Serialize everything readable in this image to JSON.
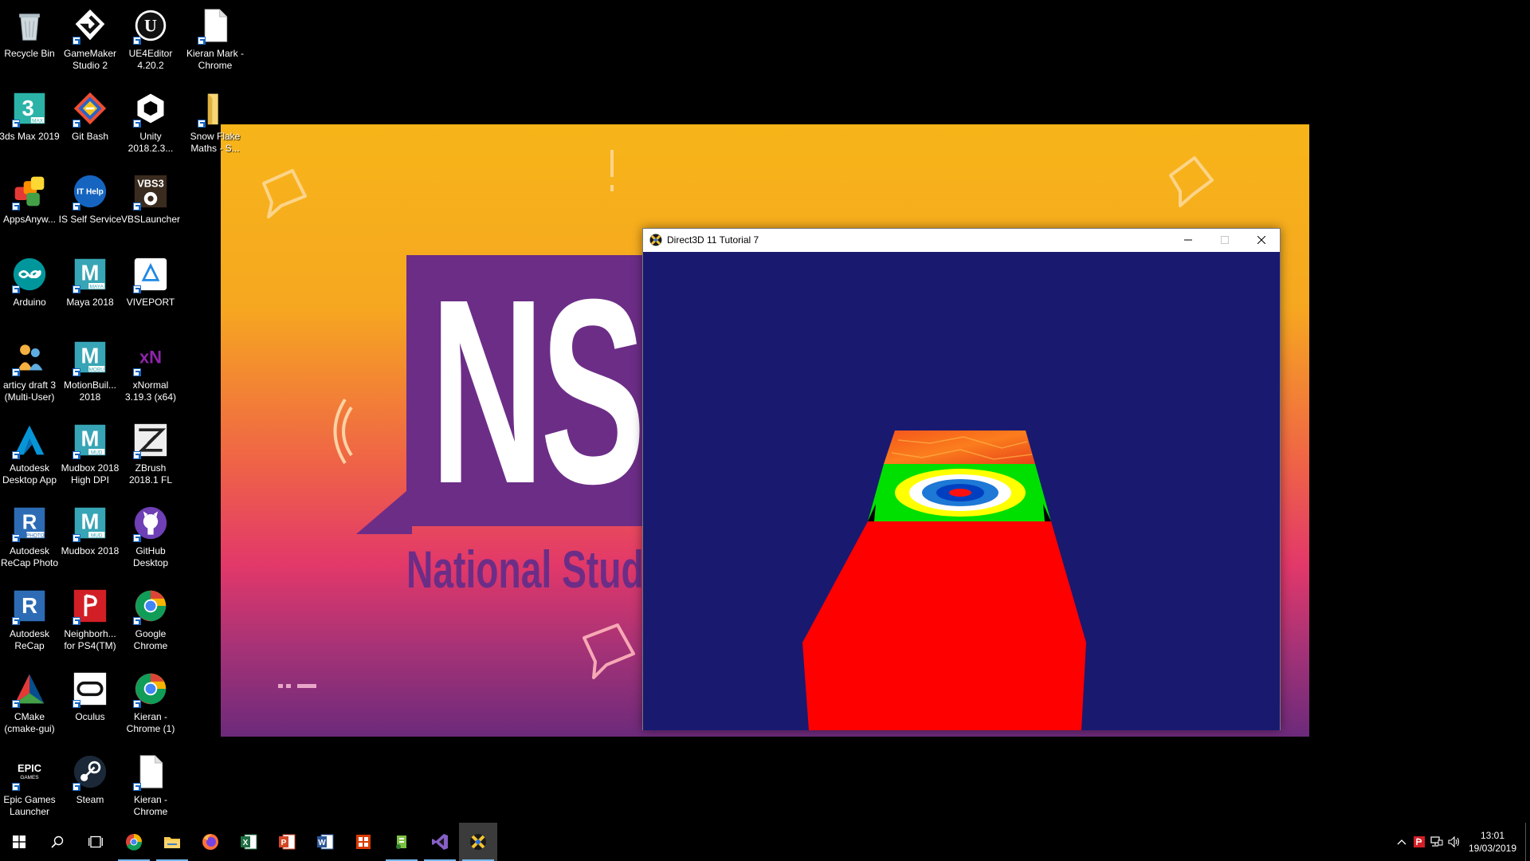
{
  "desktop_icons": [
    {
      "label": "Recycle Bin",
      "icon": "recycle-bin-icon"
    },
    {
      "label": "GameMaker\nStudio 2",
      "icon": "gamemaker-icon"
    },
    {
      "label": "UE4Editor\n4.20.2",
      "icon": "unreal-icon"
    },
    {
      "label": "Kieran Mark -\nChrome",
      "icon": "document-icon"
    },
    {
      "label": "3ds Max 2019",
      "icon": "3dsmax-icon"
    },
    {
      "label": "Git Bash",
      "icon": "git-bash-icon"
    },
    {
      "label": "Unity\n2018.2.3...",
      "icon": "unity-icon"
    },
    {
      "label": "Snow Flake\nMaths - S...",
      "icon": "folder-icon"
    },
    {
      "label": "AppsAnyw...",
      "icon": "appsanywhere-icon"
    },
    {
      "label": "IS Self Service",
      "icon": "it-help-icon"
    },
    {
      "label": "VBSLauncher",
      "icon": "vbs3-icon"
    },
    {
      "label": "Arduino",
      "icon": "arduino-icon"
    },
    {
      "label": "Maya 2018",
      "icon": "maya-icon"
    },
    {
      "label": "VIVEPORT",
      "icon": "viveport-icon"
    },
    {
      "label": "articy draft 3\n(Multi-User)",
      "icon": "articy-icon"
    },
    {
      "label": "MotionBuil...\n2018",
      "icon": "motionbuilder-icon"
    },
    {
      "label": "xNormal\n3.19.3 (x64)",
      "icon": "xnormal-icon"
    },
    {
      "label": "Autodesk\nDesktop App",
      "icon": "autodesk-icon"
    },
    {
      "label": "Mudbox 2018\nHigh DPI",
      "icon": "mudbox-icon"
    },
    {
      "label": "ZBrush\n2018.1 FL",
      "icon": "zbrush-icon"
    },
    {
      "label": "Autodesk\nReCap Photo",
      "icon": "recap-photo-icon"
    },
    {
      "label": "Mudbox 2018",
      "icon": "mudbox-icon"
    },
    {
      "label": "GitHub\nDesktop",
      "icon": "github-icon"
    },
    {
      "label": "Autodesk\nReCap",
      "icon": "recap-icon"
    },
    {
      "label": "Neighborh...\nfor PS4(TM)",
      "icon": "playstation-icon"
    },
    {
      "label": "Google\nChrome",
      "icon": "chrome-icon"
    },
    {
      "label": "CMake\n(cmake-gui)",
      "icon": "cmake-icon"
    },
    {
      "label": "Oculus",
      "icon": "oculus-icon"
    },
    {
      "label": "Kieran -\nChrome (1)",
      "icon": "chrome-icon"
    },
    {
      "label": "Epic Games\nLauncher",
      "icon": "epic-games-icon"
    },
    {
      "label": "Steam",
      "icon": "steam-icon"
    },
    {
      "label": "Kieran -\nChrome",
      "icon": "document-icon"
    }
  ],
  "wallpaper": {
    "letters": "NS",
    "subtitle": "National Stude"
  },
  "window": {
    "title": "Direct3D 11 Tutorial 7",
    "clear_color": "#191970"
  },
  "taskbar": {
    "apps": [
      {
        "icon": "chrome-icon",
        "state": "running"
      },
      {
        "icon": "file-explorer-icon",
        "state": "running"
      },
      {
        "icon": "firefox-icon",
        "state": "none"
      },
      {
        "icon": "excel-icon",
        "state": "none"
      },
      {
        "icon": "powerpoint-icon",
        "state": "none"
      },
      {
        "icon": "word-icon",
        "state": "none"
      },
      {
        "icon": "office-icon",
        "state": "none"
      },
      {
        "icon": "notepad-plus-icon",
        "state": "running"
      },
      {
        "icon": "visual-studio-icon",
        "state": "running"
      },
      {
        "icon": "directx-icon",
        "state": "current"
      }
    ],
    "clock_time": "13:01",
    "clock_date": "19/03/2019"
  }
}
